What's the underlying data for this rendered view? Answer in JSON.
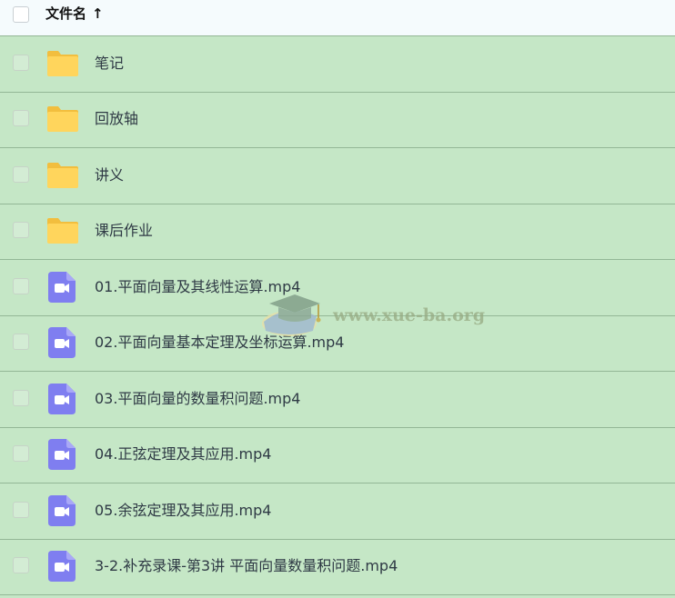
{
  "header": {
    "column_name": "文件名",
    "sort_arrow": "↑"
  },
  "files": [
    {
      "name": "笔记",
      "type": "folder"
    },
    {
      "name": "回放轴",
      "type": "folder"
    },
    {
      "name": "讲义",
      "type": "folder"
    },
    {
      "name": "课后作业",
      "type": "folder"
    },
    {
      "name": "01.平面向量及其线性运算.mp4",
      "type": "video"
    },
    {
      "name": "02.平面向量基本定理及坐标运算.mp4",
      "type": "video"
    },
    {
      "name": "03.平面向量的数量积问题.mp4",
      "type": "video"
    },
    {
      "name": "04.正弦定理及其应用.mp4",
      "type": "video"
    },
    {
      "name": "05.余弦定理及其应用.mp4",
      "type": "video"
    },
    {
      "name": "3-2.补充录课-第3讲 平面向量数量积问题.mp4",
      "type": "video"
    }
  ],
  "watermark": {
    "text": "www.xue-ba.org"
  },
  "colors": {
    "folder": "#ffd55c",
    "folder_tab": "#f2be3e",
    "video": "#7f7ef0",
    "row_bg": "#c5e7c6"
  }
}
